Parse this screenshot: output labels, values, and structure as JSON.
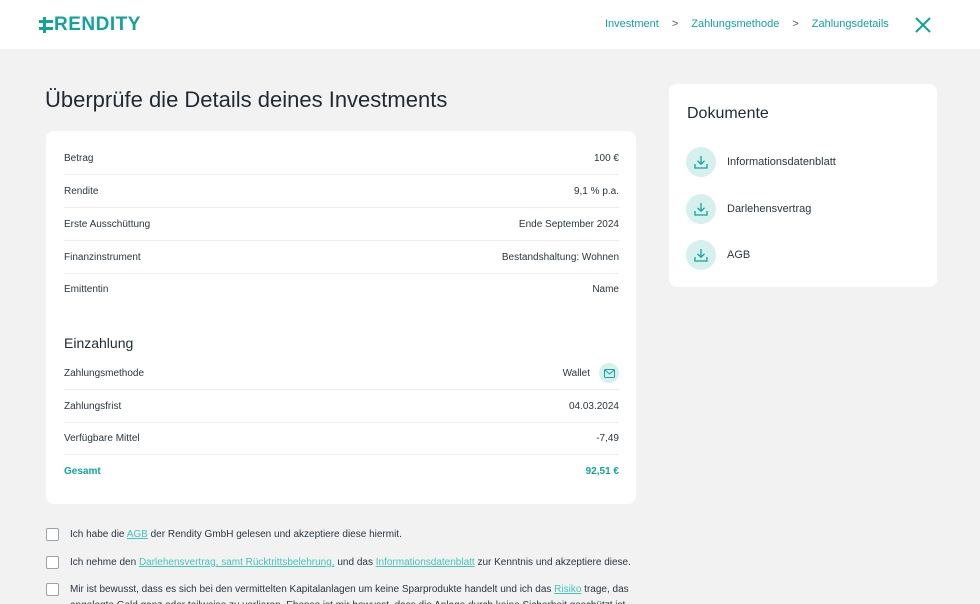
{
  "header": {
    "logo_text": "RENDITY",
    "breadcrumb": [
      "Investment",
      "Zahlungsmethode",
      "Zahlungsdetails"
    ],
    "close_icon": "close-icon"
  },
  "page_title": "Überprüfe die Details deines Investments",
  "details": [
    {
      "label": "Betrag",
      "value": "100 €"
    },
    {
      "label": "Rendite",
      "value": "9,1 % p.a."
    },
    {
      "label": "Erste Ausschüttung",
      "value": "Ende September 2024"
    },
    {
      "label": "Finanzinstrument",
      "value": "Bestandshaltung: Wohnen"
    },
    {
      "label": "Emittentin",
      "value": "Name"
    }
  ],
  "payment": {
    "title": "Einzahlung",
    "rows": [
      {
        "label": "Zahlungsmethode",
        "value": "Wallet"
      },
      {
        "label": "Zahlungsfrist",
        "value": "04.03.2024"
      },
      {
        "label": "Verfügbare Mittel",
        "value": "-7,49"
      }
    ],
    "total": {
      "label": "Gesamt",
      "value": "92,51 €"
    }
  },
  "documents": {
    "title": "Dokumente",
    "items": [
      "Informationsdatenblatt",
      "Darlehensvertrag",
      "AGB"
    ]
  },
  "consents": {
    "c1": {
      "pre": "Ich habe die ",
      "link": "AGB",
      "post": " der Rendity GmbH gelesen und akzeptiere diese hiermit."
    },
    "c2": {
      "pre": "Ich nehme den ",
      "link1": "Darlehensvertrag, samt Rücktrittsbelehrung,",
      "mid": " und das ",
      "link2": "Informationsdatenblatt",
      "post": " zur Kenntnis und akzeptiere diese."
    },
    "c3": {
      "pre": "Mir ist bewusst, dass es sich bei den vermittelten Kapitalanlagen um keine Sparprodukte handelt und ich das ",
      "link": "Risiko",
      "post": " trage, das angelegte Geld ganz oder teilweise zu verlieren. Ebenso ist mir bewusst, dass die Anlage durch keine Sicherheit geschützt ist."
    }
  },
  "colors": {
    "accent": "#12a39b",
    "link": "#44c4bb",
    "icon_bg": "#d6f0ee"
  }
}
